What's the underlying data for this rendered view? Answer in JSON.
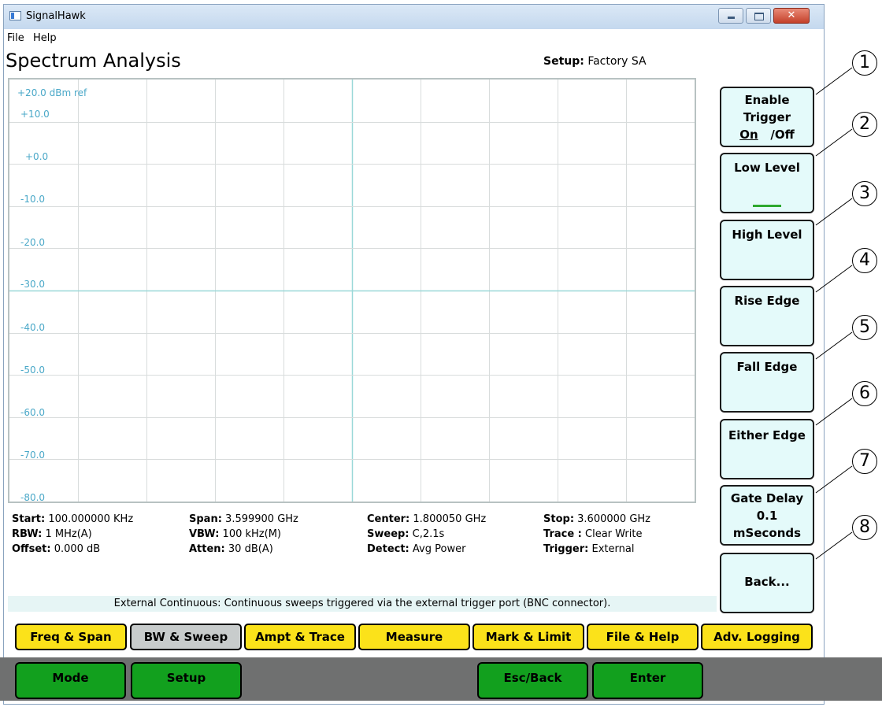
{
  "window": {
    "title": "SignalHawk",
    "close_glyph": "✕"
  },
  "menu": [
    "File",
    "Help"
  ],
  "page": {
    "title": "Spectrum Analysis",
    "setup_label": "Setup:",
    "setup_value": "Factory SA"
  },
  "plot": {
    "ref_label": "+20.0 dBm ref",
    "y_labels": [
      "+10.0",
      "+0.0",
      "-10.0",
      "-20.0",
      "-30.0",
      "-40.0",
      "-50.0",
      "-60.0",
      "-70.0",
      "-80.0"
    ],
    "grid_color": "#d8dcdc",
    "center_line_color": "#9ad8d8",
    "label_color": "#4aa8c8"
  },
  "info": {
    "start": {
      "label": "Start:",
      "value": "100.000000 KHz"
    },
    "rbw": {
      "label": "RBW:",
      "value": "1 MHz(A)"
    },
    "offset": {
      "label": "Offset:",
      "value": "0.000 dB"
    },
    "span": {
      "label": "Span:",
      "value": "3.599900 GHz"
    },
    "vbw": {
      "label": "VBW:",
      "value": "100 kHz(M)"
    },
    "atten": {
      "label": "Atten:",
      "value": "30 dB(A)"
    },
    "center": {
      "label": "Center:",
      "value": "1.800050 GHz"
    },
    "sweep": {
      "label": "Sweep:",
      "value": "C,2.1s"
    },
    "detect": {
      "label": "Detect:",
      "value": "Avg Power"
    },
    "stop": {
      "label": "Stop:",
      "value": "3.600000 GHz"
    },
    "trace": {
      "label": "Trace :",
      "value": "Clear Write"
    },
    "trigger": {
      "label": "Trigger:",
      "value": "External"
    }
  },
  "status": "External Continuous: Continuous sweeps triggered via the external trigger port (BNC connector).",
  "softkeys": {
    "enable_trigger": {
      "line1": "Enable",
      "line2": "Trigger",
      "on": "On",
      "off": "/Off"
    },
    "low_level": "Low Level",
    "high_level": "High Level",
    "rise_edge": "Rise Edge",
    "fall_edge": "Fall Edge",
    "either_edge": "Either Edge",
    "gate_delay": {
      "line1": "Gate Delay",
      "line2": "0.1",
      "line3": "mSeconds"
    },
    "back": "Back..."
  },
  "tabs": [
    {
      "label": "Freq & Span",
      "active": false
    },
    {
      "label": "BW & Sweep",
      "active": true
    },
    {
      "label": "Ampt &  Trace",
      "active": false
    },
    {
      "label": "Measure",
      "active": false
    },
    {
      "label": "Mark & Limit",
      "active": false
    },
    {
      "label": "File & Help",
      "active": false
    },
    {
      "label": "Adv. Logging",
      "active": false
    }
  ],
  "bottom_buttons": {
    "mode": "Mode",
    "setup": "Setup",
    "esc_back": "Esc/Back",
    "enter": "Enter"
  },
  "callouts": [
    "1",
    "2",
    "3",
    "4",
    "5",
    "6",
    "7",
    "8"
  ],
  "colors": {
    "tab_yellow": "#fbe21a",
    "tab_active": "#c8cccc",
    "button_green": "#12a01e",
    "softkey_bg": "#e4fafa",
    "bottom_bar": "#6f7070"
  }
}
